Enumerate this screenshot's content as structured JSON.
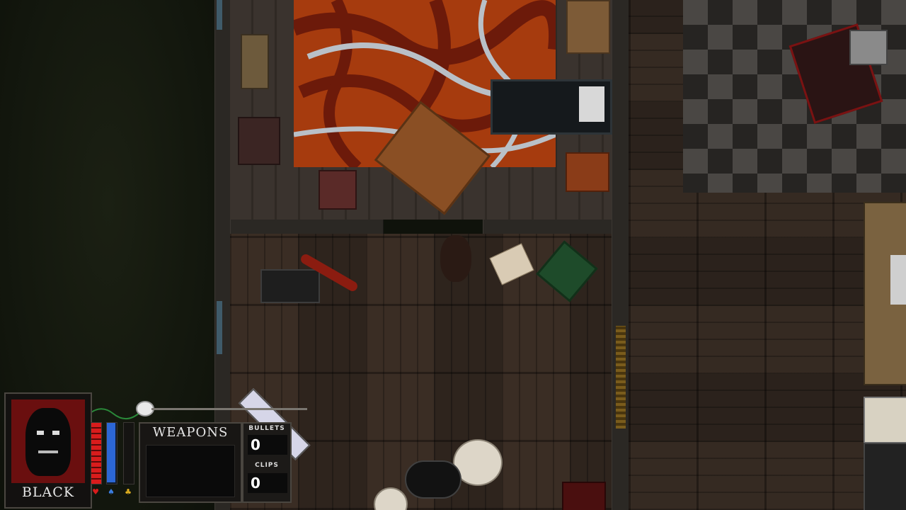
{
  "hud": {
    "character_name": "BLACK",
    "weapons_title": "WEAPONS",
    "bullets_label": "BULLETS",
    "bullets_value": "0",
    "clips_label": "CLIPS",
    "clips_value": "0",
    "health_level": 1.0,
    "energy_level": 1.0,
    "icons": [
      "heart-icon",
      "rage-icon",
      "key-icon"
    ]
  },
  "colors": {
    "health": "#d91c1c",
    "energy": "#2c67d6",
    "portrait_bg": "#6a0f0f"
  }
}
